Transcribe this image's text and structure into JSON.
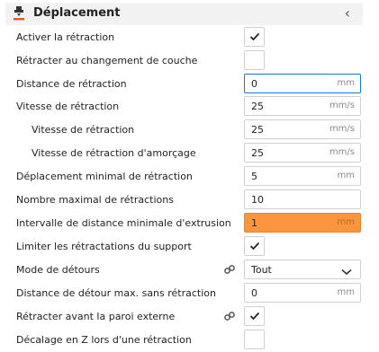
{
  "section": {
    "title": "Déplacement",
    "icon": "travel-icon",
    "collapse_icon": "chevron-left-icon"
  },
  "rows": {
    "activer_retraction": {
      "label": "Activer la rétraction",
      "checked": true
    },
    "retracter_couche": {
      "label": "Rétracter au changement de couche",
      "checked": false
    },
    "distance_retraction": {
      "label": "Distance de rétraction",
      "value": "0",
      "unit": "mm"
    },
    "vitesse_retraction": {
      "label": "Vitesse de rétraction",
      "value": "25",
      "unit": "mm/s"
    },
    "vitesse_retraction_sub": {
      "label": "Vitesse de rétraction",
      "value": "25",
      "unit": "mm/s"
    },
    "vitesse_amorcage": {
      "label": "Vitesse de rétraction d'amorçage",
      "value": "25",
      "unit": "mm/s"
    },
    "deplacement_min": {
      "label": "Déplacement minimal de rétraction",
      "value": "5",
      "unit": "mm"
    },
    "nombre_max": {
      "label": "Nombre maximal de rétractions",
      "value": "10"
    },
    "intervalle_distance": {
      "label": "Intervalle de distance minimale d'extrusion",
      "value": "1",
      "unit": "mm"
    },
    "limiter_support": {
      "label": "Limiter les rétractations du support",
      "checked": true
    },
    "mode_detours": {
      "label": "Mode de détours",
      "value": "Tout"
    },
    "distance_detour": {
      "label": "Distance de détour max. sans rétraction",
      "value": "0",
      "unit": "mm"
    },
    "retracter_paroi": {
      "label": "Rétracter avant la paroi externe",
      "checked": true
    },
    "decalage_z": {
      "label": "Décalage en Z lors d'une rétraction",
      "checked": false
    }
  },
  "colors": {
    "focus_border": "#1b77d4",
    "error_fill": "#fb963f"
  }
}
